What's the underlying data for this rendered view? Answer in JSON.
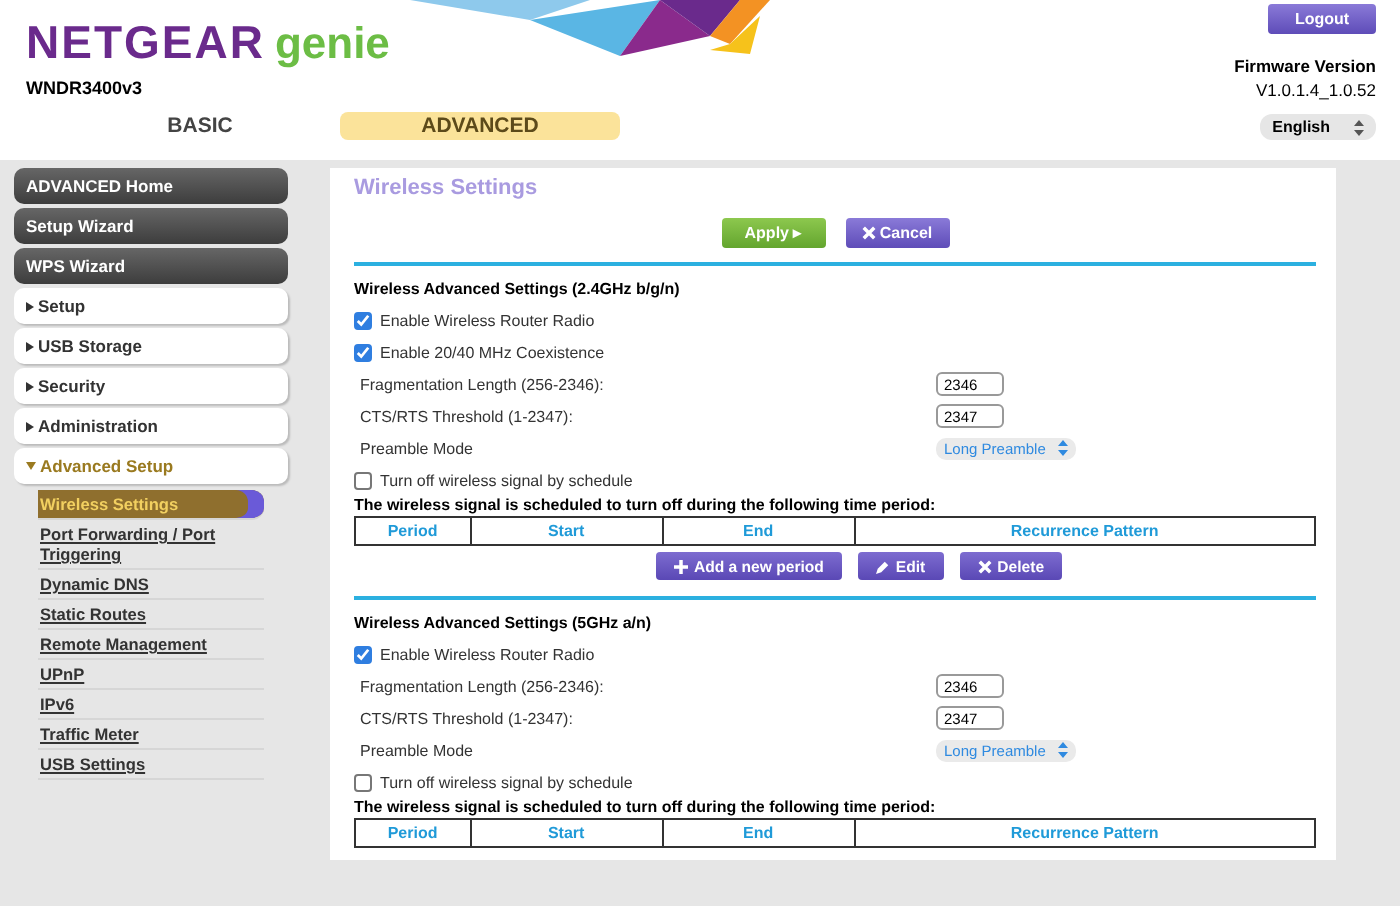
{
  "header": {
    "brand": "NETGEAR",
    "product": "genie",
    "model": "WNDR3400v3",
    "logout": "Logout",
    "firmware_label": "Firmware Version",
    "firmware_version": "V1.0.1.4_1.0.52",
    "language": "English"
  },
  "tabs": [
    {
      "label": "BASIC",
      "selected": false
    },
    {
      "label": "ADVANCED",
      "selected": true
    }
  ],
  "sidebar": {
    "items": [
      {
        "label": "ADVANCED Home",
        "kind": "button"
      },
      {
        "label": "Setup Wizard",
        "kind": "button"
      },
      {
        "label": "WPS Wizard",
        "kind": "button"
      },
      {
        "label": "Setup",
        "kind": "group",
        "expanded": false
      },
      {
        "label": "USB Storage",
        "kind": "group",
        "expanded": false
      },
      {
        "label": "Security",
        "kind": "group",
        "expanded": false
      },
      {
        "label": "Administration",
        "kind": "group",
        "expanded": false
      },
      {
        "label": "Advanced Setup",
        "kind": "group",
        "expanded": true,
        "children": [
          {
            "label": "Wireless Settings",
            "selected": true
          },
          {
            "label": "Port Forwarding / Port Triggering",
            "selected": false
          },
          {
            "label": "Dynamic DNS",
            "selected": false
          },
          {
            "label": "Static Routes",
            "selected": false
          },
          {
            "label": "Remote Management",
            "selected": false
          },
          {
            "label": "UPnP",
            "selected": false
          },
          {
            "label": "IPv6",
            "selected": false
          },
          {
            "label": "Traffic Meter",
            "selected": false
          },
          {
            "label": "USB Settings",
            "selected": false
          }
        ]
      }
    ]
  },
  "content": {
    "title": "Wireless Settings",
    "apply": "Apply ▸",
    "cancel": "Cancel",
    "sections": [
      {
        "heading": "Wireless Advanced Settings (2.4GHz b/g/n)",
        "options": [
          {
            "label": "Enable Wireless Router Radio",
            "checked": true
          },
          {
            "label": "Enable 20/40 MHz Coexistence",
            "checked": true
          }
        ],
        "fields": [
          {
            "label": "Fragmentation Length (256-2346):",
            "value": "2346"
          },
          {
            "label": "CTS/RTS Threshold (1-2347):",
            "value": "2347"
          }
        ],
        "preamble_label": "Preamble Mode",
        "preamble": "Long Preamble",
        "schedule": {
          "label": "Turn off wireless signal by schedule",
          "checked": false
        },
        "schedule_note": "The wireless signal is scheduled to turn off during the following time period:",
        "columns": [
          "Period",
          "Start",
          "End",
          "Recurrence Pattern"
        ],
        "buttons": [
          {
            "label": "Add a new period",
            "kind": "add"
          },
          {
            "label": "Edit",
            "kind": "edit"
          },
          {
            "label": "Delete",
            "kind": "delete"
          }
        ]
      },
      {
        "heading": "Wireless Advanced Settings (5GHz a/n)",
        "options": [
          {
            "label": "Enable Wireless Router Radio",
            "checked": true
          }
        ],
        "fields": [
          {
            "label": "Fragmentation Length (256-2346):",
            "value": "2346"
          },
          {
            "label": "CTS/RTS Threshold (1-2347):",
            "value": "2347"
          }
        ],
        "preamble_label": "Preamble Mode",
        "preamble": "Long Preamble",
        "schedule": {
          "label": "Turn off wireless signal by schedule",
          "checked": false
        },
        "schedule_note": "The wireless signal is scheduled to turn off during the following time period:",
        "columns": [
          "Period",
          "Start",
          "End",
          "Recurrence Pattern"
        ]
      }
    ]
  }
}
